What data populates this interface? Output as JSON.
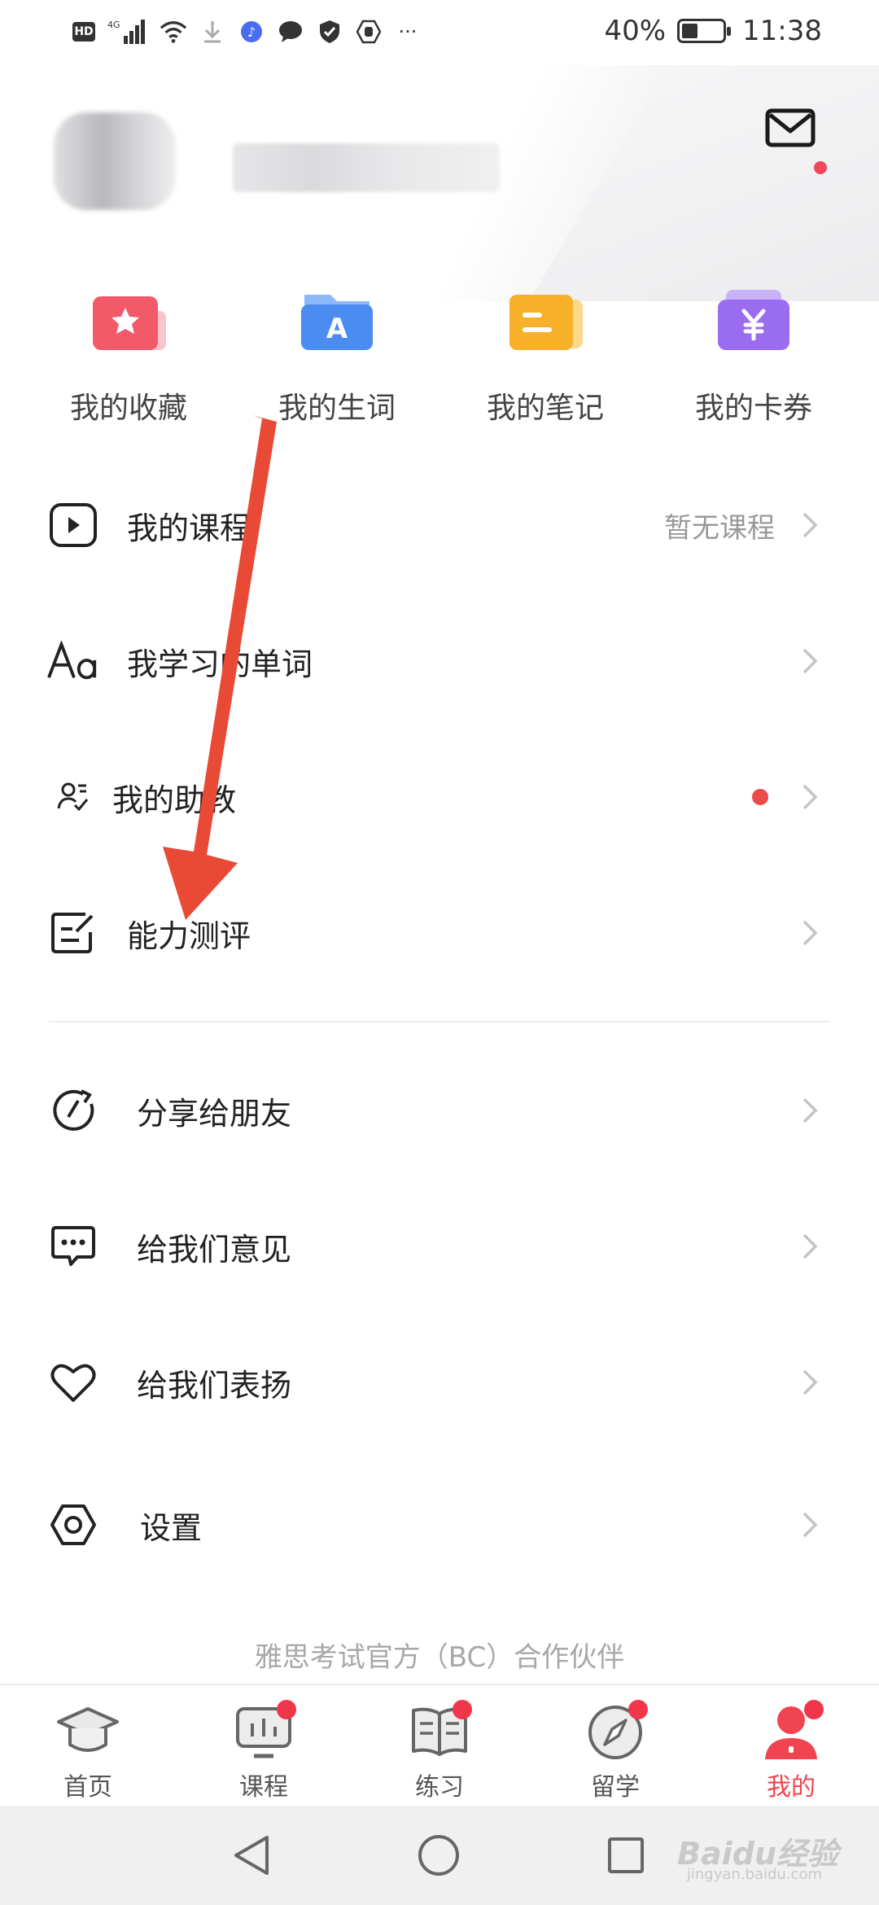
{
  "status_bar": {
    "network": "4G",
    "hd": "HD",
    "battery": "40%",
    "battery_level": 0.4,
    "time": "11:38",
    "more": "···"
  },
  "header": {
    "mail_has_unread": true
  },
  "quick_actions": [
    {
      "label": "我的收藏",
      "icon": "star-folder-icon",
      "color": "#f25a6a"
    },
    {
      "label": "我的生词",
      "icon": "letter-a-folder-icon",
      "color": "#4a8cf0"
    },
    {
      "label": "我的笔记",
      "icon": "note-icon",
      "color": "#f6b02a"
    },
    {
      "label": "我的卡券",
      "icon": "yen-coupon-icon",
      "color": "#9a6cf0"
    }
  ],
  "menu_items": [
    {
      "label": "我的课程",
      "sub": "暂无课程",
      "icon": "play-icon"
    },
    {
      "label": "我学习的单词",
      "icon": "font-aa-icon"
    },
    {
      "label": "我的助教",
      "icon": "assistant-icon",
      "has_dot": true
    },
    {
      "label": "能力测评",
      "icon": "edit-note-icon"
    }
  ],
  "menu_items_2": [
    {
      "label": "分享给朋友",
      "icon": "share-icon"
    },
    {
      "label": "给我们意见",
      "icon": "feedback-icon"
    },
    {
      "label": "给我们表扬",
      "icon": "heart-icon"
    },
    {
      "label": "设置",
      "icon": "settings-icon"
    }
  ],
  "partner_text": "雅思考试官方（BC）合作伙伴",
  "tabs": [
    {
      "label": "首页",
      "icon": "graduation-cap-icon",
      "badge": false
    },
    {
      "label": "课程",
      "icon": "screen-icon",
      "badge": true
    },
    {
      "label": "练习",
      "icon": "book-icon",
      "badge": true
    },
    {
      "label": "留学",
      "icon": "compass-icon",
      "badge": true
    },
    {
      "label": "我的",
      "icon": "user-icon",
      "badge": true,
      "active": true
    }
  ],
  "watermark": {
    "text": "Baidu经验",
    "sub": "jingyan.baidu.com"
  }
}
